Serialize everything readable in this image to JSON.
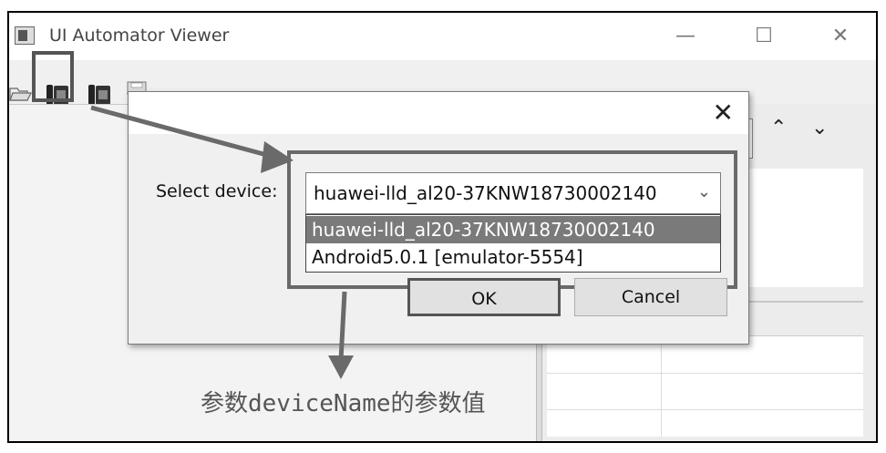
{
  "window": {
    "title": "UI Automator Viewer",
    "controls": {
      "minimize": "—",
      "maximize": "☐",
      "close": "✕"
    }
  },
  "toolbar": {
    "icons": [
      "open-folder-icon",
      "device-screenshot-icon",
      "device-screenshot-compressed-icon",
      "save-icon"
    ]
  },
  "right_panel": {
    "nav_up": "⌃",
    "nav_down": "⌄"
  },
  "dialog": {
    "close": "✕",
    "label": "Select device:",
    "selected_value": "huawei-lld_al20-37KNW18730002140",
    "options": [
      "huawei-lld_al20-37KNW18730002140",
      "Android5.0.1 [emulator-5554]"
    ],
    "ok_label": "OK",
    "cancel_label": "Cancel"
  },
  "annotation": {
    "caption": "参数deviceName的参数值"
  },
  "colors": {
    "frame": "#000000",
    "highlight": "#555555",
    "selected_option_bg": "#7a7a7a"
  }
}
